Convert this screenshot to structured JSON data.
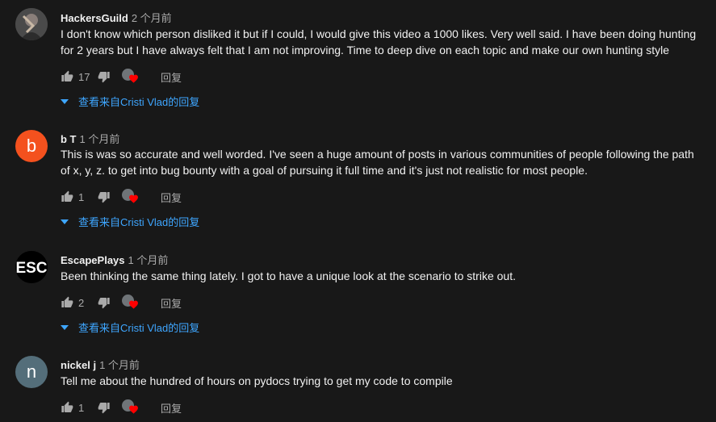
{
  "comments": [
    {
      "author": "HackersGuild",
      "time": "2 个月前",
      "text": "I don't know which person disliked it but if I could, I would give this video a 1000 likes. Very well said. I have been doing hunting for 2 years but I have always felt that I am not improving. Time to deep dive on each topic and make our own hunting style",
      "likes": "17",
      "reply_label": "回复",
      "view_replies": "查看来自Cristi Vlad的回复",
      "avatar_icon": "profile-photo-icon"
    },
    {
      "author": "b T",
      "time": "1 个月前",
      "text": "This is was so accurate and well worded. I've seen a huge amount of posts in various communities of people following the path of x, y, z. to get into bug bounty with a goal of pursuing it full time and it's just not realistic for most people.",
      "likes": "1",
      "reply_label": "回复",
      "view_replies": "查看来自Cristi Vlad的回复",
      "avatar_letter": "b",
      "avatar_color": "#f4511e"
    },
    {
      "author": "EscapePlays",
      "time": "1 个月前",
      "text": "Been thinking the same thing lately. I  got to have a unique look at the scenario to strike out.",
      "likes": "2",
      "reply_label": "回复",
      "view_replies": "查看来自Cristi Vlad的回复",
      "avatar_logo": "ESC"
    },
    {
      "author": "nickel j",
      "time": "1 个月前",
      "text": "Tell me about the hundred of hours on pydocs trying to get my code to compile",
      "likes": "1",
      "reply_label": "回复",
      "avatar_letter": "n",
      "avatar_color": "#546e7a"
    }
  ],
  "colors": {
    "background": "#181818",
    "link": "#3ea6ff",
    "heart": "#ff0000",
    "secondary_text": "#aaaaaa"
  }
}
